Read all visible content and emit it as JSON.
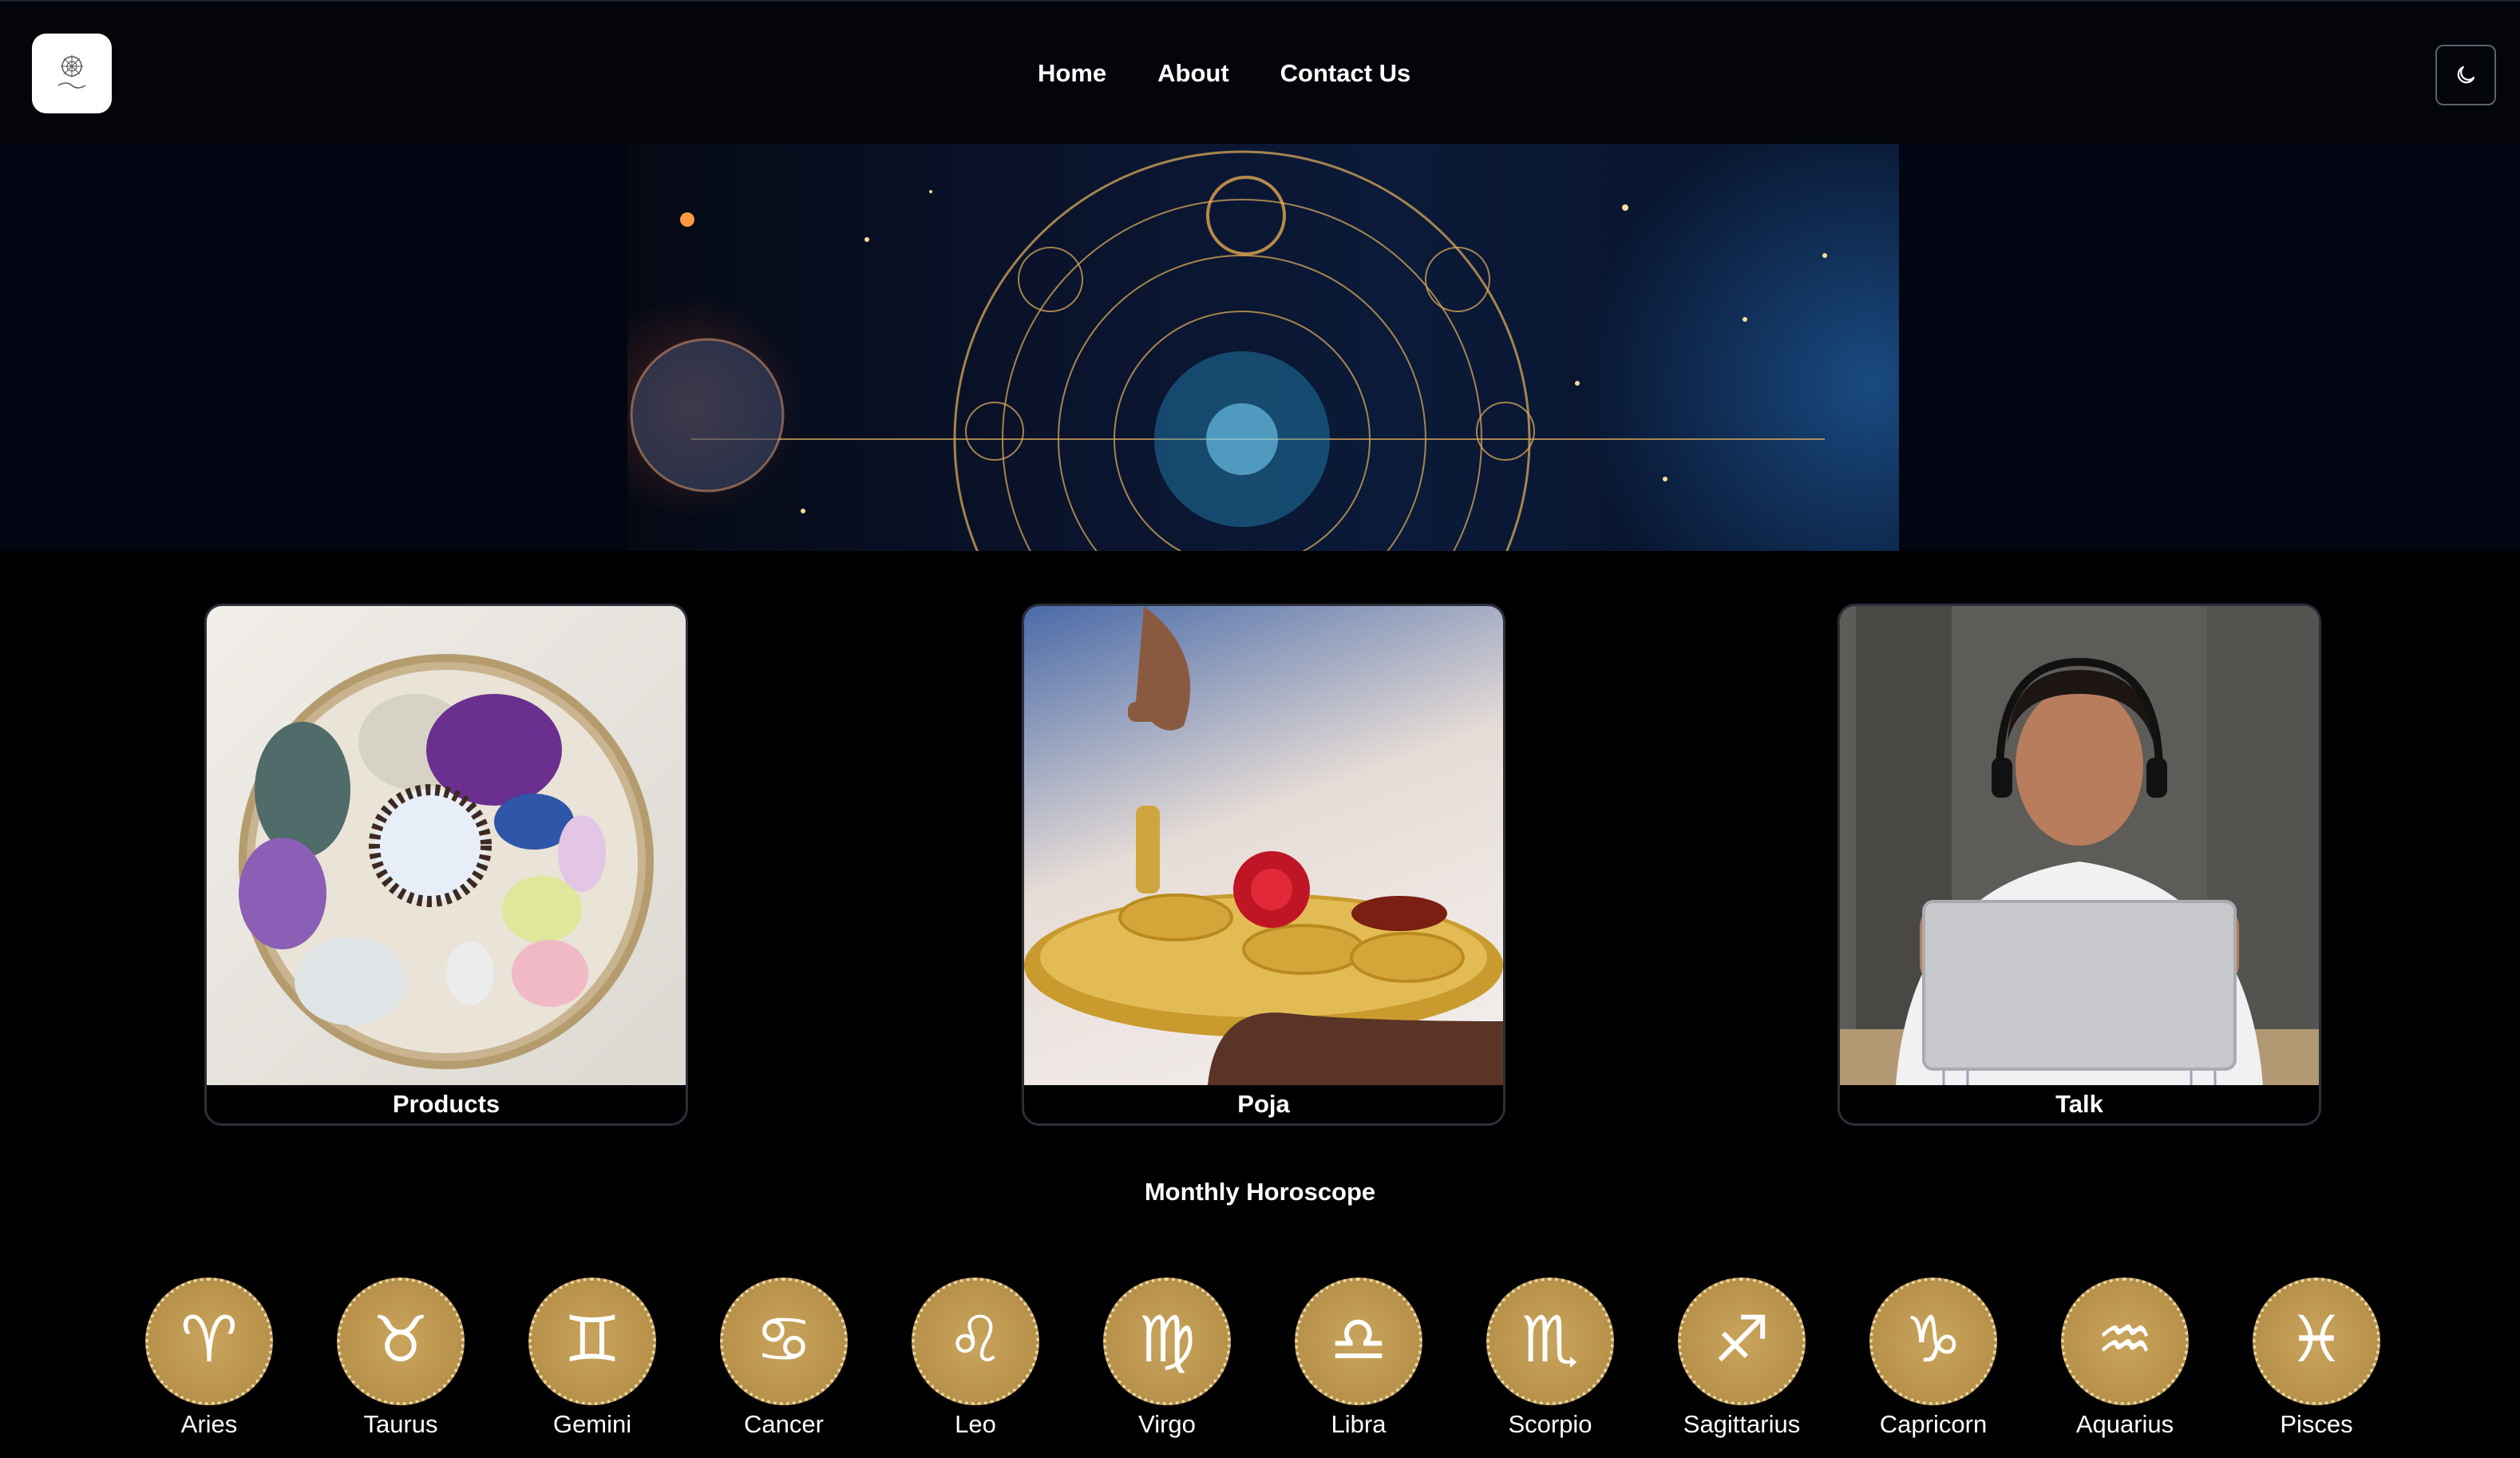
{
  "header": {
    "logo_alt": "Astrology",
    "nav": [
      {
        "label": "Home"
      },
      {
        "label": "About"
      },
      {
        "label": "Contact Us"
      }
    ],
    "theme_toggle_icon": "moon-icon"
  },
  "cards": [
    {
      "label": "Products",
      "image": "crystals-bowl-image"
    },
    {
      "label": "Poja",
      "image": "puja-thali-image"
    },
    {
      "label": "Talk",
      "image": "astrologer-video-call-image"
    }
  ],
  "horoscope": {
    "title": "Monthly Horoscope",
    "signs": [
      {
        "name": "Aries",
        "glyph": "♈"
      },
      {
        "name": "Taurus",
        "glyph": "♉"
      },
      {
        "name": "Gemini",
        "glyph": "♊"
      },
      {
        "name": "Cancer",
        "glyph": "♋"
      },
      {
        "name": "Leo",
        "glyph": "♌"
      },
      {
        "name": "Virgo",
        "glyph": "♍"
      },
      {
        "name": "Libra",
        "glyph": "♎"
      },
      {
        "name": "Scorpio",
        "glyph": "♏"
      },
      {
        "name": "Sagittarius",
        "glyph": "♐"
      },
      {
        "name": "Capricorn",
        "glyph": "♑"
      },
      {
        "name": "Aquarius",
        "glyph": "♒"
      },
      {
        "name": "Pisces",
        "glyph": "♓"
      }
    ]
  },
  "colors": {
    "background": "#000000",
    "header": "#03050a",
    "zodiac_gold": "#b8924a"
  }
}
